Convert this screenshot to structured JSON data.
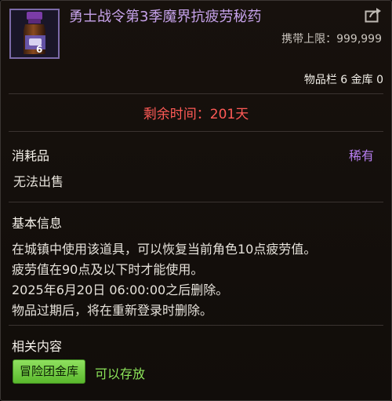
{
  "item": {
    "name": "勇士战令第3季魔界抗疲劳秘药",
    "icon": "potion-bottle-icon",
    "stack_count": "6",
    "carry_limit": "携带上限：999,999",
    "storage": "物品栏 6 金库 0"
  },
  "remaining": {
    "text": "剩余时间：201天",
    "color": "#ff5a56"
  },
  "category": {
    "type": "消耗品",
    "rarity": "稀有",
    "rarity_color": "#b77ef0",
    "trade": "无法出售"
  },
  "info": {
    "title": "基本信息",
    "lines": [
      "在城镇中使用该道具，可以恢复当前角色10点疲劳值。",
      "疲劳值在90点及以下时才能使用。",
      "2025年6月20日 06:00:00之后删除。",
      "物品过期后，将在重新登录时删除。"
    ]
  },
  "related": {
    "title": "相关内容",
    "tag_label": "冒险团金库",
    "tag_desc": "可以存放"
  },
  "colors": {
    "name": "#c6a2ea",
    "accent_green": "#8de55a"
  }
}
